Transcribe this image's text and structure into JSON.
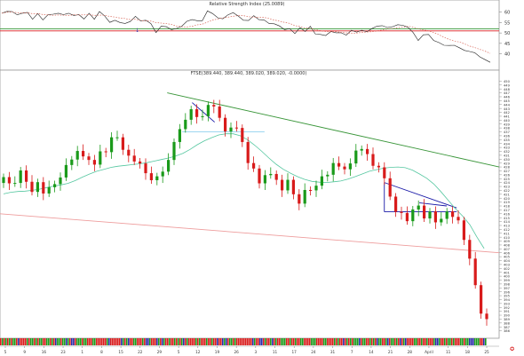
{
  "chart_data": [
    {
      "type": "line",
      "title": "Relative Strength Index (25.0089)",
      "ylim": [
        33,
        62
      ],
      "y_ticks": [
        40,
        45,
        50,
        55,
        60
      ],
      "reference_lines": [
        52,
        51
      ],
      "series": [
        {
          "values": [
            59.5,
            60.4,
            60.3,
            58.7,
            59.5,
            59.9,
            56.6,
            59.3,
            56.3,
            58.8,
            59.0,
            59.5,
            58.8,
            59.5,
            58.4,
            58.8,
            56.7,
            59.5,
            56.6,
            60.3,
            58.2,
            55.1,
            56.1,
            55.0,
            54.6,
            55.5,
            58.0,
            55.8,
            56.1,
            54.5,
            50.2,
            53.2,
            53.0,
            51.6,
            52.2,
            53.2,
            55.6,
            56.4,
            55.9,
            55.9,
            60.6,
            59.3,
            57.3,
            56.8,
            58.7,
            59.8,
            58.1,
            56.1,
            56.0,
            58.3,
            56.4,
            56.3,
            54.5,
            54.4,
            53.4,
            51.6,
            52.1,
            49.7,
            52.6,
            50.7,
            53.2,
            49.4,
            49.3,
            48.8,
            50.7,
            50.1,
            50.1,
            49.0,
            51.3,
            50.4,
            51.3,
            50.6,
            52.1,
            53.3,
            53.5,
            52.6,
            53.0,
            54.0,
            53.7,
            52.7,
            50.2,
            46.4,
            49.1,
            49.3,
            46.4,
            45.4,
            44.1,
            44.0,
            44.1,
            42.9,
            41.6,
            41.1,
            40.5,
            38.5,
            37.2,
            35.9
          ]
        }
      ]
    },
    {
      "type": "candlestick",
      "title": "FTSE(389.440, 389.440, 389.020, 389.020, -0.0000)",
      "xlabel": "",
      "ylabel": "",
      "ylim": [
        385,
        451
      ],
      "y_ticks": [
        "386",
        "387",
        "388",
        "389",
        "390",
        "391",
        "392",
        "393",
        "394",
        "395",
        "396",
        "397",
        "398",
        "399",
        "400",
        "401",
        "402",
        "403",
        "404",
        "405",
        "406",
        "407",
        "408",
        "409",
        "410",
        "411",
        "412",
        "413",
        "414",
        "415",
        "416",
        "417",
        "418",
        "419",
        "420",
        "421",
        "422",
        "423",
        "424",
        "425",
        "426",
        "427",
        "428",
        "429",
        "430",
        "431",
        "432",
        "433",
        "434",
        "435",
        "436",
        "437",
        "438",
        "439",
        "440",
        "441",
        "442",
        "443",
        "444",
        "445",
        "446",
        "447",
        "448",
        "449",
        "450"
      ],
      "x_labels": [
        "5",
        "9",
        "16",
        "23",
        "1",
        "8",
        "15",
        "22",
        "29",
        "5",
        "12",
        "19",
        "26",
        "3",
        "11",
        "17",
        "24",
        "31",
        "7",
        "14",
        "21",
        "28",
        "April",
        "11",
        "18",
        "25"
      ],
      "series": [
        {
          "name": "close",
          "values": [
            425.4,
            423.8,
            423.9,
            427.1,
            424.2,
            421.6,
            424.1,
            421.2,
            422.8,
            423.6,
            425.3,
            428.5,
            429.9,
            432.1,
            430.7,
            429.8,
            428.6,
            432.0,
            431.8,
            435.6,
            435.6,
            432.4,
            430.9,
            429.4,
            428.9,
            426.4,
            424.6,
            425.6,
            426.8,
            429.8,
            434.4,
            437.7,
            440.1,
            442.8,
            440.8,
            441.0,
            443.9,
            443.5,
            440.6,
            437.1,
            438.1,
            438.0,
            434.4,
            429.0,
            427.6,
            423.8,
            425.9,
            426.2,
            424.7,
            422.0,
            424.7,
            421.0,
            418.6,
            422.1,
            422.0,
            423.2,
            425.6,
            426.0,
            429.0,
            428.1,
            427.4,
            428.9,
            432.2,
            432.6,
            431.3,
            428.3,
            427.9,
            425.1,
            420.4,
            416.5,
            416.2,
            414.1,
            417.1,
            418.1,
            414.8,
            416.6,
            413.8,
            414.7,
            416.6,
            415.2,
            414.3,
            409.3,
            404.5,
            397.7,
            390.4,
            389.0
          ],
          "ma": [
            421.1,
            421.5,
            421.7,
            421.8,
            422.0,
            422.3,
            422.7,
            423.1,
            423.4,
            423.8,
            424.5,
            425.4,
            426.2,
            426.9,
            427.4,
            427.9,
            428.2,
            428.4,
            428.6,
            428.8,
            429.1,
            429.5,
            429.9,
            430.3,
            430.8,
            431.5,
            432.5,
            433.7,
            434.7,
            435.5,
            436.2,
            436.5,
            436.5,
            436.0,
            435.0,
            433.6,
            432.0,
            430.3,
            428.7,
            427.4,
            426.4,
            425.5,
            424.8,
            424.3,
            424.1,
            424.0,
            424.2,
            424.4,
            424.9,
            425.5,
            426.2,
            426.9,
            427.3,
            427.7,
            427.9,
            428.0,
            427.8,
            427.2,
            426.2,
            425.1,
            423.6,
            421.6,
            419.4,
            417.3,
            415.4,
            413.2,
            410.0,
            407.1
          ]
        }
      ],
      "trendlines": [
        {
          "from": [
            0,
            416.0
          ],
          "to": [
            1,
            406.0
          ],
          "color": "#ee9d9d"
        },
        {
          "from": [
            0.335,
            447.0
          ],
          "to": [
            1,
            428.0
          ],
          "color": "#3a963a"
        },
        {
          "from": [
            0.365,
            437.0
          ],
          "to": [
            0.53,
            437.0
          ],
          "color": "#8fd0ef"
        },
        {
          "from": [
            0.385,
            444.5
          ],
          "to": [
            0.43,
            439.5
          ],
          "color": "#1a1aa8"
        },
        {
          "from": [
            0.77,
            424.0
          ],
          "to": [
            0.915,
            417.5
          ],
          "color": "#1a1aa8"
        },
        {
          "from": [
            0.77,
            416.5
          ],
          "to": [
            0.915,
            416.5
          ],
          "color": "#1a1aa8"
        },
        {
          "from": [
            0.77,
            424.0
          ],
          "to": [
            0.77,
            416.5
          ],
          "color": "#1a1aa8"
        },
        {
          "from": [
            0.84,
            418.8
          ],
          "to": [
            0.895,
            418.0
          ],
          "color": "#1a1aa8"
        }
      ],
      "arrow": "↓"
    }
  ],
  "colors": {
    "up": "#1a9a1a",
    "down": "#d81b1b",
    "ma": "#55c7a0",
    "rsi": "#222222",
    "rsi_ma": "#d14b3b",
    "blue_line": "#4caff0"
  }
}
